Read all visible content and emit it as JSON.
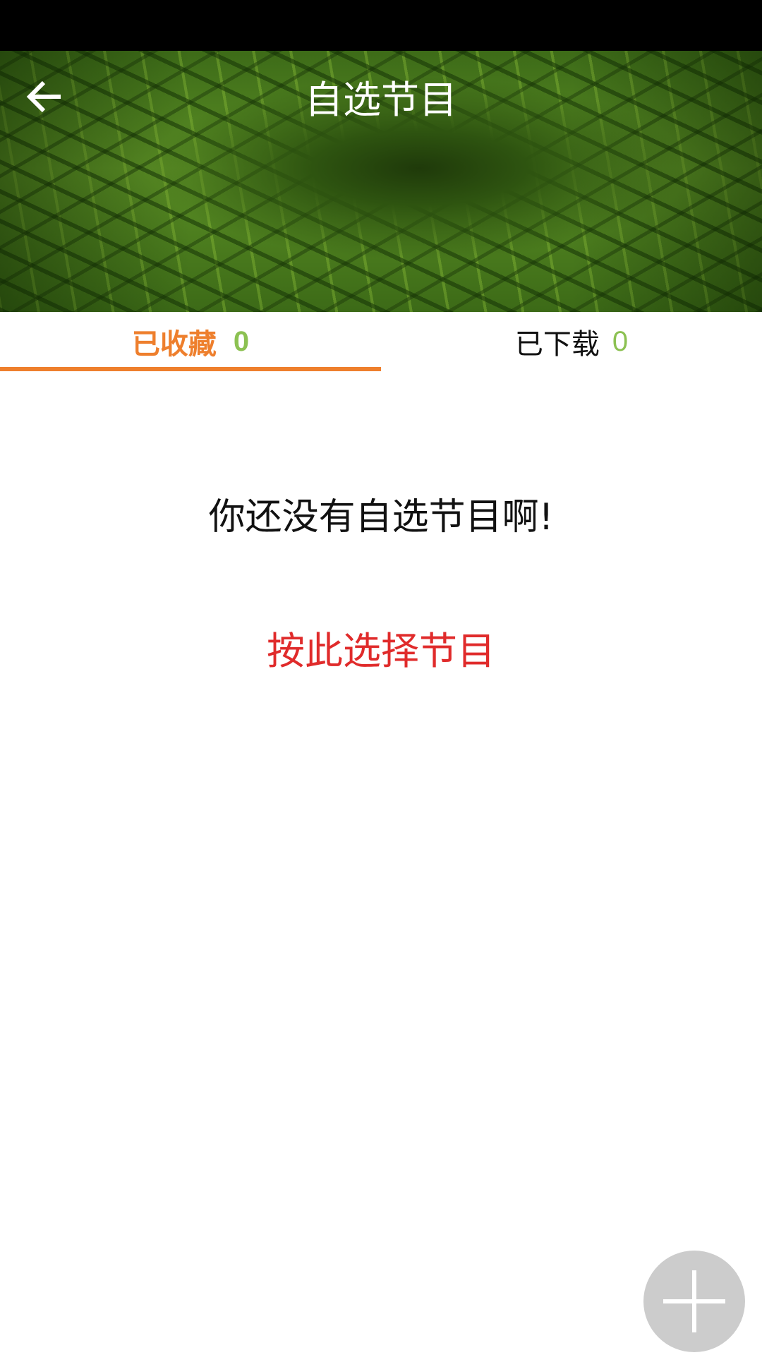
{
  "header": {
    "title": "自选节目",
    "back_icon": "arrow-left-icon"
  },
  "tabs": [
    {
      "label": "已收藏",
      "count": "0",
      "active": true
    },
    {
      "label": "已下载",
      "count": "0",
      "active": false
    }
  ],
  "empty_state": {
    "message": "你还没有自选节目啊!",
    "action_label": "按此选择节目"
  },
  "fab": {
    "icon": "plus-icon"
  },
  "colors": {
    "accent_orange": "#ee7f2d",
    "count_green": "#8cc152",
    "action_red": "#e02b2b",
    "fab_gray": "#cccccc"
  }
}
